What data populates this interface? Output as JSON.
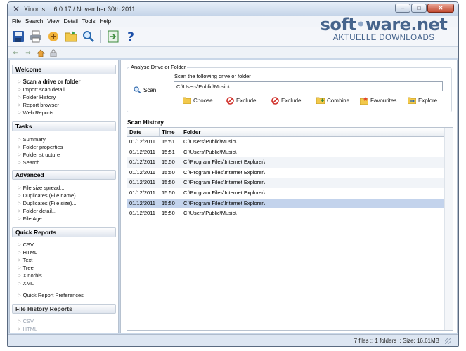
{
  "window": {
    "title": "Xinor   is ... 6.0.17 / November 30th 2011",
    "minimize": "–",
    "maximize": "□",
    "close": "✕"
  },
  "menu": [
    "File",
    "Search",
    "View",
    "Detail",
    "Tools",
    "Help"
  ],
  "watermark": {
    "brand_a": "soft",
    "brand_dot": "•",
    "brand_b": "ware.net",
    "tagline": "AKTUELLE DOWNLOADS"
  },
  "sidebar": {
    "welcome": {
      "header": "Welcome",
      "items": [
        "Scan a drive or folder",
        "Import scan detail",
        "Folder History",
        "Report browser",
        "Web Reports"
      ]
    },
    "tasks": {
      "header": "Tasks",
      "items": [
        "Summary",
        "Folder properties",
        "Folder structure",
        "Search"
      ]
    },
    "advanced": {
      "header": "Advanced",
      "items": [
        "File size spread...",
        "Duplicates (File name)...",
        "Duplicates (File size)...",
        "Folder detail...",
        "File Age..."
      ]
    },
    "quick_reports": {
      "header": "Quick Reports",
      "items": [
        "CSV",
        "HTML",
        "Text",
        "Tree",
        "Xinorbis",
        "XML",
        "Quick Report Preferences"
      ]
    },
    "file_history": {
      "header": "File History Reports",
      "items": [
        "CSV",
        "HTML"
      ]
    }
  },
  "analyse": {
    "group_label": "Analyse Drive or Folder",
    "scan_label": "Scan",
    "prompt": "Scan the following drive or folder",
    "path_value": "C:\\Users\\Public\\Music\\",
    "actions": {
      "choose": "Choose",
      "exclude1": "Exclude",
      "exclude2": "Exclude",
      "combine": "Combine",
      "favourites": "Favourites",
      "explore": "Explore"
    }
  },
  "history": {
    "title": "Scan History",
    "columns": [
      "Date",
      "Time",
      "Folder"
    ],
    "rows": [
      {
        "date": "01/12/2011",
        "time": "15:51",
        "folder": "C:\\Users\\Public\\Music\\"
      },
      {
        "date": "01/12/2011",
        "time": "15:51",
        "folder": "C:\\Users\\Public\\Music\\"
      },
      {
        "date": "01/12/2011",
        "time": "15:50",
        "folder": "C:\\Program Files\\Internet Explorer\\"
      },
      {
        "date": "01/12/2011",
        "time": "15:50",
        "folder": "C:\\Program Files\\Internet Explorer\\"
      },
      {
        "date": "01/12/2011",
        "time": "15:50",
        "folder": "C:\\Program Files\\Internet Explorer\\"
      },
      {
        "date": "01/12/2011",
        "time": "15:50",
        "folder": "C:\\Program Files\\Internet Explorer\\"
      },
      {
        "date": "01/12/2011",
        "time": "15:50",
        "folder": "C:\\Program Files\\Internet Explorer\\"
      },
      {
        "date": "01/12/2011",
        "time": "15:50",
        "folder": "C:\\Users\\Public\\Music\\"
      }
    ],
    "selected_row": 6
  },
  "status": {
    "text": "7 files :: 1 folders :: Size: 16,61MB"
  },
  "colors": {
    "accent": "#46648c",
    "selection": "#c3d3ec"
  },
  "icons": [
    "app-icon",
    "save-icon",
    "print-icon",
    "scan-icon",
    "open-folder-icon",
    "search-icon",
    "export-icon",
    "help-icon",
    "back-icon",
    "forward-icon",
    "home-icon",
    "lock-icon",
    "magnifier-icon",
    "folder-icon",
    "exclude-icon",
    "combine-icon",
    "favourites-icon",
    "explore-icon"
  ]
}
